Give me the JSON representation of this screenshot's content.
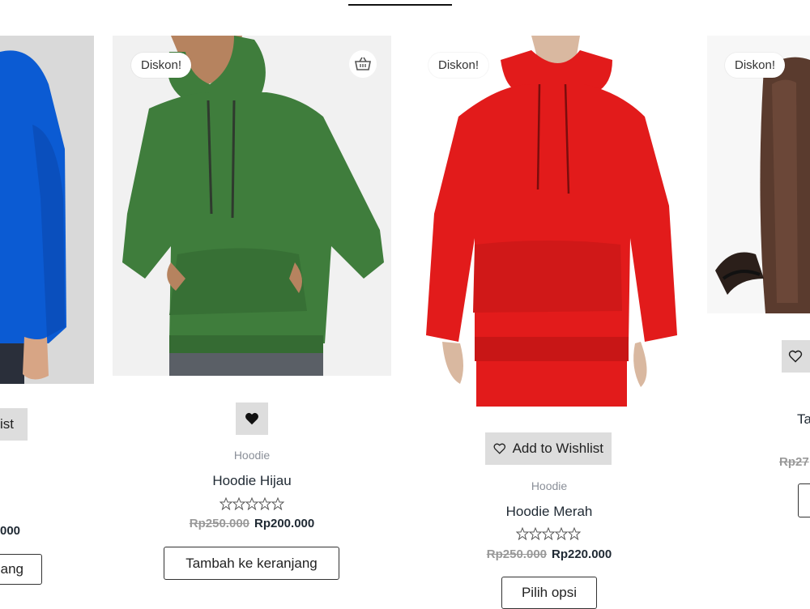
{
  "products": [
    {
      "wishlist_label_partial": "ist",
      "price_partial": "000",
      "cart_label_partial": "ang"
    },
    {
      "badge": "Diskon!",
      "category": "Hoodie",
      "title": "Hoodie Hijau",
      "price_old": "Rp250.000",
      "price_new": "Rp200.000",
      "rating": 0,
      "button": "Tambah ke keranjang",
      "icon": "basket-icon",
      "hoodie_color": "#3f7d3c"
    },
    {
      "badge": "Diskon!",
      "wishlist_label": "Add to Wishlist",
      "category": "Hoodie",
      "title": "Hoodie Merah",
      "price_old": "Rp250.000",
      "price_new": "Rp220.000",
      "rating": 0,
      "button": "Pilih opsi",
      "hoodie_color": "#e21b1b"
    },
    {
      "badge": "Diskon!",
      "title_partial": "Ta",
      "price_partial": "Rp27",
      "bag_color": "#5a3b2e"
    }
  ],
  "colors": {
    "first_hoodie": "#0b5bd3",
    "wishlist_bg": "#dddddd"
  }
}
